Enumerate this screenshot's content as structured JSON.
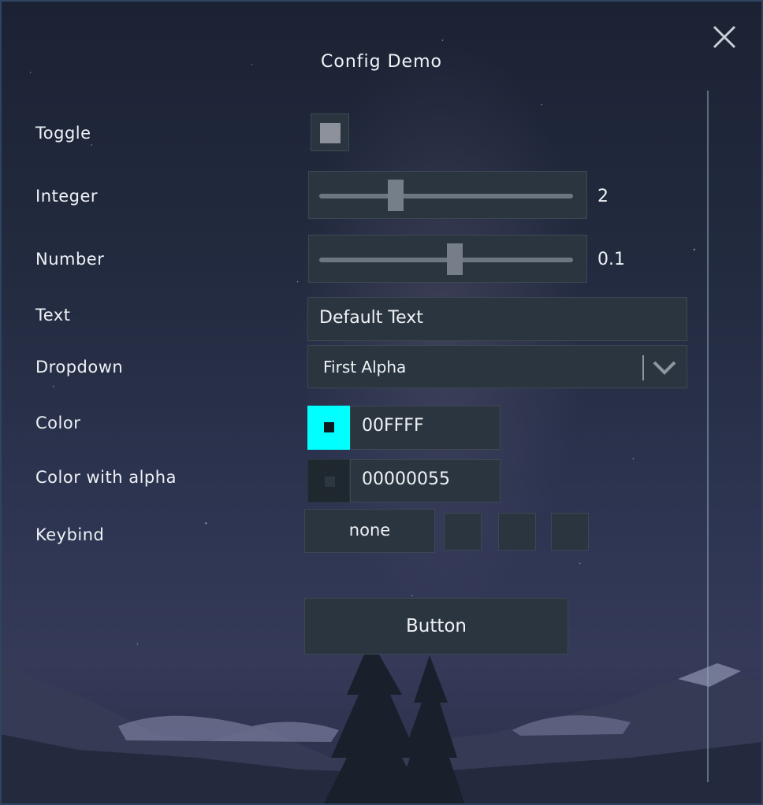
{
  "window": {
    "title": "Config Demo"
  },
  "fields": {
    "toggle": {
      "label": "Toggle",
      "checked": false
    },
    "integer": {
      "label": "Integer",
      "value": "2",
      "fraction": 0.3
    },
    "number": {
      "label": "Number",
      "value": "0.1",
      "fraction": 0.53
    },
    "text": {
      "label": "Text",
      "value": "Default Text"
    },
    "dropdown": {
      "label": "Dropdown",
      "selected": "First Alpha"
    },
    "color": {
      "label": "Color",
      "hex": "00FFFF",
      "swatch_color": "#00ffff"
    },
    "color_alpha": {
      "label": "Color with alpha",
      "hex": "00000055",
      "swatch_color": "#1f272f"
    },
    "keybind": {
      "label": "Keybind",
      "value": "none"
    }
  },
  "button": {
    "label": "Button"
  },
  "icons": {
    "close": "close-icon",
    "dropdown": "chevron-down-icon"
  },
  "colors": {
    "panel": "#2b353f",
    "panel_border": "#3d4853",
    "accent": "#00ffff"
  }
}
